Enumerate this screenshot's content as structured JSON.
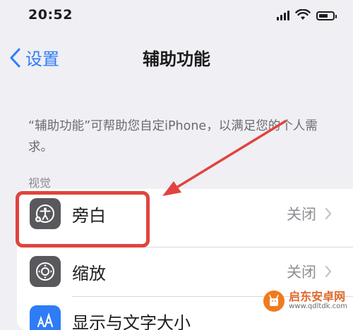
{
  "status_bar": {
    "time": "20:52",
    "icons": [
      "signal-icon",
      "wifi-icon",
      "battery-icon"
    ]
  },
  "nav": {
    "back_label": "设置",
    "title": "辅助功能"
  },
  "description": "“辅助功能”可帮助您自定iPhone，以满足您的个人需求。",
  "section_header": "视觉",
  "rows": [
    {
      "label": "旁白",
      "value": "关闭",
      "icon": "voiceover-icon"
    },
    {
      "label": "缩放",
      "value": "关闭",
      "icon": "zoom-icon"
    },
    {
      "label": "显示与文字大小",
      "value": "",
      "icon": "display-text-size-icon"
    }
  ],
  "annotation": {
    "color": "#e0443e"
  },
  "watermark": {
    "title": "启东安卓网",
    "url": "www.qdltdk.com"
  },
  "colors": {
    "accent": "#2f7df6",
    "background": "#efeff4",
    "icon_gray": "#58585d",
    "icon_blue": "#2e7cf6"
  }
}
